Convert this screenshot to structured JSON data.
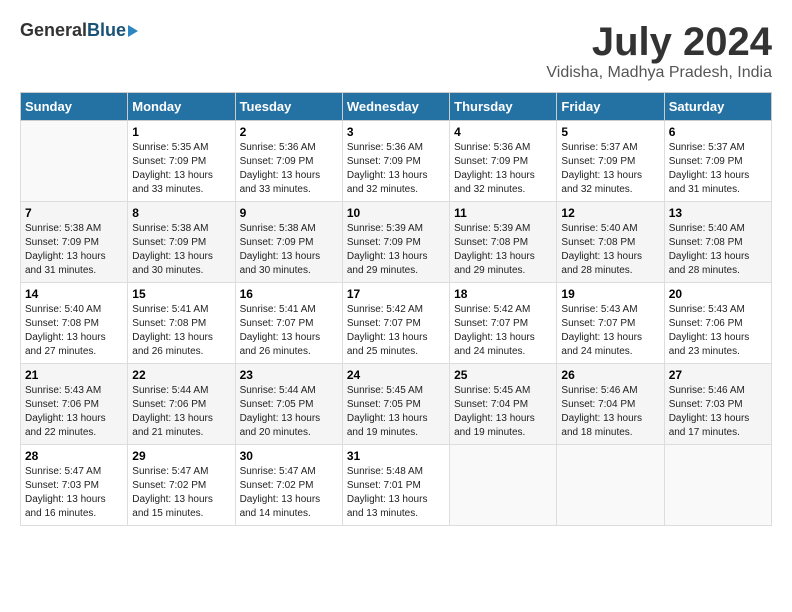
{
  "header": {
    "logo_general": "General",
    "logo_blue": "Blue",
    "month_year": "July 2024",
    "location": "Vidisha, Madhya Pradesh, India"
  },
  "weekdays": [
    "Sunday",
    "Monday",
    "Tuesday",
    "Wednesday",
    "Thursday",
    "Friday",
    "Saturday"
  ],
  "weeks": [
    [
      {
        "day": "",
        "info": ""
      },
      {
        "day": "1",
        "info": "Sunrise: 5:35 AM\nSunset: 7:09 PM\nDaylight: 13 hours\nand 33 minutes."
      },
      {
        "day": "2",
        "info": "Sunrise: 5:36 AM\nSunset: 7:09 PM\nDaylight: 13 hours\nand 33 minutes."
      },
      {
        "day": "3",
        "info": "Sunrise: 5:36 AM\nSunset: 7:09 PM\nDaylight: 13 hours\nand 32 minutes."
      },
      {
        "day": "4",
        "info": "Sunrise: 5:36 AM\nSunset: 7:09 PM\nDaylight: 13 hours\nand 32 minutes."
      },
      {
        "day": "5",
        "info": "Sunrise: 5:37 AM\nSunset: 7:09 PM\nDaylight: 13 hours\nand 32 minutes."
      },
      {
        "day": "6",
        "info": "Sunrise: 5:37 AM\nSunset: 7:09 PM\nDaylight: 13 hours\nand 31 minutes."
      }
    ],
    [
      {
        "day": "7",
        "info": "Sunrise: 5:38 AM\nSunset: 7:09 PM\nDaylight: 13 hours\nand 31 minutes."
      },
      {
        "day": "8",
        "info": "Sunrise: 5:38 AM\nSunset: 7:09 PM\nDaylight: 13 hours\nand 30 minutes."
      },
      {
        "day": "9",
        "info": "Sunrise: 5:38 AM\nSunset: 7:09 PM\nDaylight: 13 hours\nand 30 minutes."
      },
      {
        "day": "10",
        "info": "Sunrise: 5:39 AM\nSunset: 7:09 PM\nDaylight: 13 hours\nand 29 minutes."
      },
      {
        "day": "11",
        "info": "Sunrise: 5:39 AM\nSunset: 7:08 PM\nDaylight: 13 hours\nand 29 minutes."
      },
      {
        "day": "12",
        "info": "Sunrise: 5:40 AM\nSunset: 7:08 PM\nDaylight: 13 hours\nand 28 minutes."
      },
      {
        "day": "13",
        "info": "Sunrise: 5:40 AM\nSunset: 7:08 PM\nDaylight: 13 hours\nand 28 minutes."
      }
    ],
    [
      {
        "day": "14",
        "info": "Sunrise: 5:40 AM\nSunset: 7:08 PM\nDaylight: 13 hours\nand 27 minutes."
      },
      {
        "day": "15",
        "info": "Sunrise: 5:41 AM\nSunset: 7:08 PM\nDaylight: 13 hours\nand 26 minutes."
      },
      {
        "day": "16",
        "info": "Sunrise: 5:41 AM\nSunset: 7:07 PM\nDaylight: 13 hours\nand 26 minutes."
      },
      {
        "day": "17",
        "info": "Sunrise: 5:42 AM\nSunset: 7:07 PM\nDaylight: 13 hours\nand 25 minutes."
      },
      {
        "day": "18",
        "info": "Sunrise: 5:42 AM\nSunset: 7:07 PM\nDaylight: 13 hours\nand 24 minutes."
      },
      {
        "day": "19",
        "info": "Sunrise: 5:43 AM\nSunset: 7:07 PM\nDaylight: 13 hours\nand 24 minutes."
      },
      {
        "day": "20",
        "info": "Sunrise: 5:43 AM\nSunset: 7:06 PM\nDaylight: 13 hours\nand 23 minutes."
      }
    ],
    [
      {
        "day": "21",
        "info": "Sunrise: 5:43 AM\nSunset: 7:06 PM\nDaylight: 13 hours\nand 22 minutes."
      },
      {
        "day": "22",
        "info": "Sunrise: 5:44 AM\nSunset: 7:06 PM\nDaylight: 13 hours\nand 21 minutes."
      },
      {
        "day": "23",
        "info": "Sunrise: 5:44 AM\nSunset: 7:05 PM\nDaylight: 13 hours\nand 20 minutes."
      },
      {
        "day": "24",
        "info": "Sunrise: 5:45 AM\nSunset: 7:05 PM\nDaylight: 13 hours\nand 19 minutes."
      },
      {
        "day": "25",
        "info": "Sunrise: 5:45 AM\nSunset: 7:04 PM\nDaylight: 13 hours\nand 19 minutes."
      },
      {
        "day": "26",
        "info": "Sunrise: 5:46 AM\nSunset: 7:04 PM\nDaylight: 13 hours\nand 18 minutes."
      },
      {
        "day": "27",
        "info": "Sunrise: 5:46 AM\nSunset: 7:03 PM\nDaylight: 13 hours\nand 17 minutes."
      }
    ],
    [
      {
        "day": "28",
        "info": "Sunrise: 5:47 AM\nSunset: 7:03 PM\nDaylight: 13 hours\nand 16 minutes."
      },
      {
        "day": "29",
        "info": "Sunrise: 5:47 AM\nSunset: 7:02 PM\nDaylight: 13 hours\nand 15 minutes."
      },
      {
        "day": "30",
        "info": "Sunrise: 5:47 AM\nSunset: 7:02 PM\nDaylight: 13 hours\nand 14 minutes."
      },
      {
        "day": "31",
        "info": "Sunrise: 5:48 AM\nSunset: 7:01 PM\nDaylight: 13 hours\nand 13 minutes."
      },
      {
        "day": "",
        "info": ""
      },
      {
        "day": "",
        "info": ""
      },
      {
        "day": "",
        "info": ""
      }
    ]
  ]
}
